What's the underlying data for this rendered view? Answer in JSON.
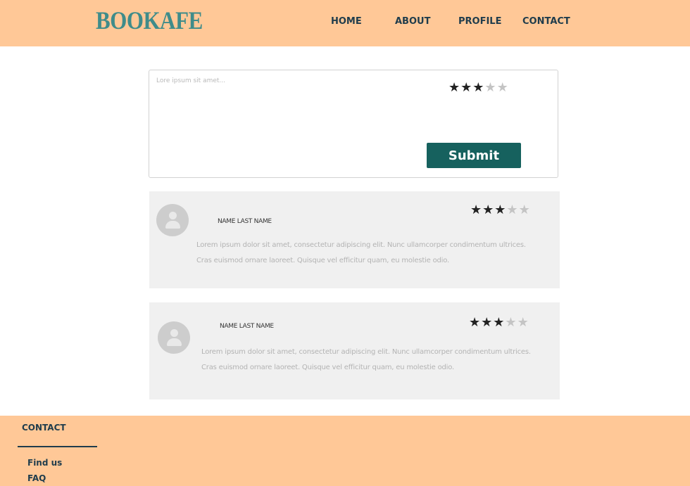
{
  "header": {
    "logo": "BOOKAFE",
    "nav": [
      {
        "label": "HOME"
      },
      {
        "label": "ABOUT"
      },
      {
        "label": "PROFILE"
      },
      {
        "label": "CONTACT"
      }
    ]
  },
  "composer": {
    "placeholder": "Lore ipsum sit amet...",
    "rating": 3,
    "max_rating": 5,
    "submit_label": "Submit"
  },
  "reviews": [
    {
      "name": "NAME LAST NAME",
      "rating": 3,
      "max_rating": 5,
      "text": "Lorem ipsum dolor sit amet, consectetur adipiscing elit. Nunc ullamcorper condimentum ultrices. Cras euismod ornare laoreet.     Quisque vel efficitur quam, eu molestie odio."
    },
    {
      "name": "NAME LAST NAME",
      "rating": 3,
      "max_rating": 5,
      "text": "Lorem ipsum dolor sit amet, consectetur adipiscing elit. Nunc ullamcorper condimentum ultrices. Cras euismod ornare laoreet.     Quisque vel efficitur quam, eu molestie odio."
    }
  ],
  "footer": {
    "title": "CONTACT",
    "links": [
      {
        "label": "Find us"
      },
      {
        "label": "FAQ"
      }
    ]
  },
  "colors": {
    "header_bg": "#ffc897",
    "logo": "#3f8c8a",
    "accent_button": "#16615e",
    "nav_text": "#1f3c4c",
    "card_bg": "#f0f0f0"
  },
  "icons": {
    "star": "star-icon",
    "avatar": "user-avatar-icon"
  }
}
